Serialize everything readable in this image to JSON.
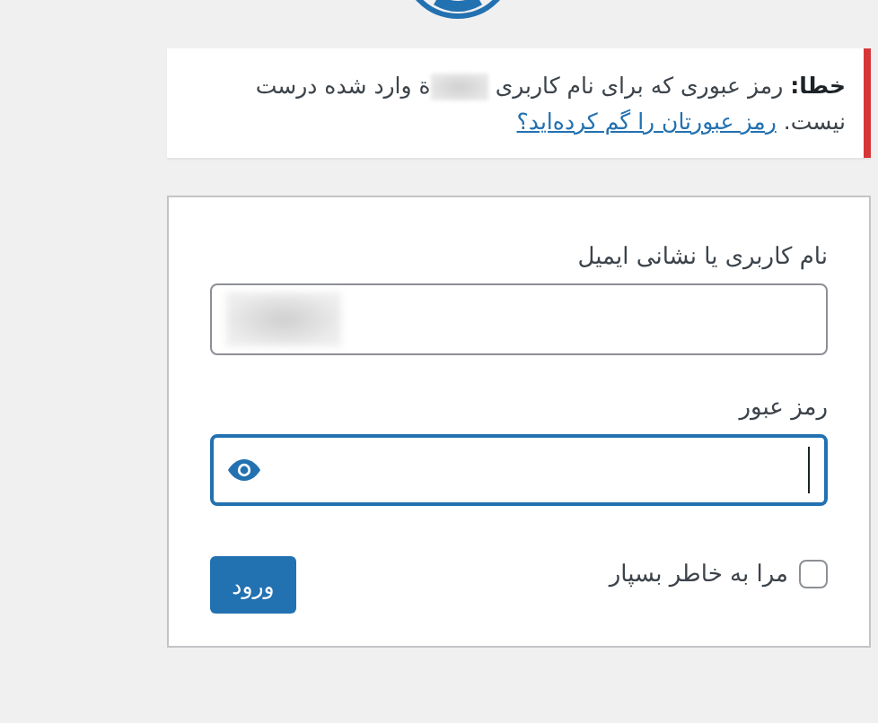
{
  "notice": {
    "label": "خطا:",
    "text_before": "رمز عبوری که برای نام کاربری",
    "username_redacted": true,
    "text_after": "ة وارد شده درست نیست.",
    "link": "رمز عبورتان را گم کرده‌اید؟"
  },
  "form": {
    "username": {
      "label": "نام کاربری یا نشانی ایمیل",
      "value_redacted": true
    },
    "password": {
      "label": "رمز عبور",
      "focused": true
    },
    "remember": {
      "label": "مرا به خاطر بسپار",
      "checked": false
    },
    "submit": "ورود"
  }
}
